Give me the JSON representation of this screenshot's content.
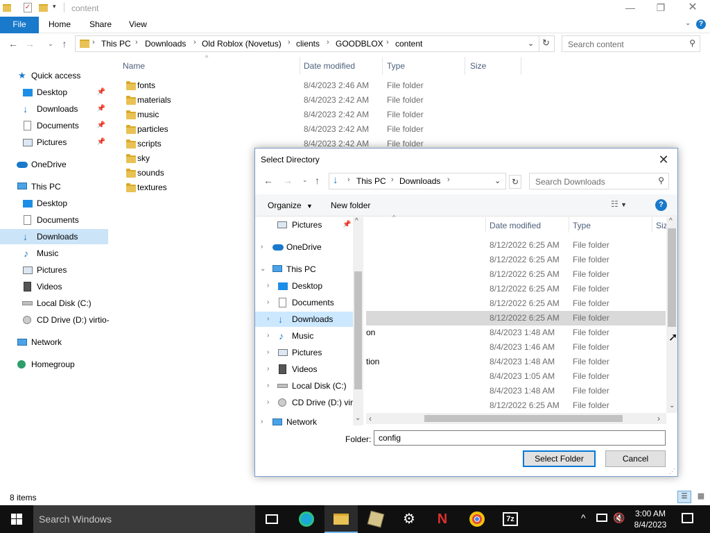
{
  "explorer": {
    "title": "content",
    "ribbon_tabs": [
      "File",
      "Home",
      "Share",
      "View"
    ],
    "breadcrumb": [
      "This PC",
      "Downloads",
      "Old Roblox (Novetus)",
      "clients",
      "GOODBLOX",
      "content"
    ],
    "search_placeholder": "Search content",
    "columns": {
      "name": "Name",
      "date": "Date modified",
      "type": "Type",
      "size": "Size"
    },
    "files": [
      {
        "name": "fonts",
        "date": "8/4/2023 2:46 AM",
        "type": "File folder"
      },
      {
        "name": "materials",
        "date": "8/4/2023 2:42 AM",
        "type": "File folder"
      },
      {
        "name": "music",
        "date": "8/4/2023 2:42 AM",
        "type": "File folder"
      },
      {
        "name": "particles",
        "date": "8/4/2023 2:42 AM",
        "type": "File folder"
      },
      {
        "name": "scripts",
        "date": "8/4/2023 2:42 AM",
        "type": "File folder"
      },
      {
        "name": "sky",
        "date": "",
        "type": ""
      },
      {
        "name": "sounds",
        "date": "",
        "type": ""
      },
      {
        "name": "textures",
        "date": "",
        "type": ""
      }
    ],
    "nav": {
      "quick_access": "Quick access",
      "qa_items": [
        "Desktop",
        "Downloads",
        "Documents",
        "Pictures"
      ],
      "onedrive": "OneDrive",
      "this_pc": "This PC",
      "pc_items": [
        "Desktop",
        "Documents",
        "Downloads",
        "Music",
        "Pictures",
        "Videos",
        "Local Disk (C:)",
        "CD Drive (D:) virtio-"
      ],
      "network": "Network",
      "homegroup": "Homegroup"
    },
    "status": "8 items"
  },
  "dialog": {
    "title": "Select Directory",
    "breadcrumb": [
      "This PC",
      "Downloads"
    ],
    "search_placeholder": "Search Downloads",
    "organize": "Organize",
    "new_folder": "New folder",
    "columns": {
      "date": "Date modified",
      "type": "Type",
      "size": "Siz"
    },
    "tree": {
      "pictures_top": "Pictures",
      "onedrive": "OneDrive",
      "this_pc": "This PC",
      "pc_items": [
        "Desktop",
        "Documents",
        "Downloads",
        "Music",
        "Pictures",
        "Videos",
        "Local Disk (C:)",
        "CD Drive (D:) virt"
      ],
      "network": "Network"
    },
    "rows": [
      {
        "name": "",
        "date": "8/12/2022 6:25 AM",
        "type": "File folder"
      },
      {
        "name": "",
        "date": "8/12/2022 6:25 AM",
        "type": "File folder"
      },
      {
        "name": "",
        "date": "8/12/2022 6:25 AM",
        "type": "File folder"
      },
      {
        "name": "",
        "date": "8/12/2022 6:25 AM",
        "type": "File folder"
      },
      {
        "name": "",
        "date": "8/12/2022 6:25 AM",
        "type": "File folder"
      },
      {
        "name": "",
        "date": "8/12/2022 6:25 AM",
        "type": "File folder"
      },
      {
        "name": "on",
        "date": "8/4/2023 1:48 AM",
        "type": "File folder"
      },
      {
        "name": "",
        "date": "8/4/2023 1:46 AM",
        "type": "File folder"
      },
      {
        "name": "tion",
        "date": "8/4/2023 1:48 AM",
        "type": "File folder"
      },
      {
        "name": "",
        "date": "8/4/2023 1:05 AM",
        "type": "File folder"
      },
      {
        "name": "",
        "date": "8/4/2023 1:48 AM",
        "type": "File folder"
      },
      {
        "name": "",
        "date": "8/12/2022 6:25 AM",
        "type": "File folder"
      }
    ],
    "folder_label": "Folder:",
    "folder_value": "config",
    "select_button": "Select Folder",
    "cancel_button": "Cancel"
  },
  "taskbar": {
    "search_placeholder": "Search Windows",
    "time": "3:00 AM",
    "date": "8/4/2023"
  }
}
